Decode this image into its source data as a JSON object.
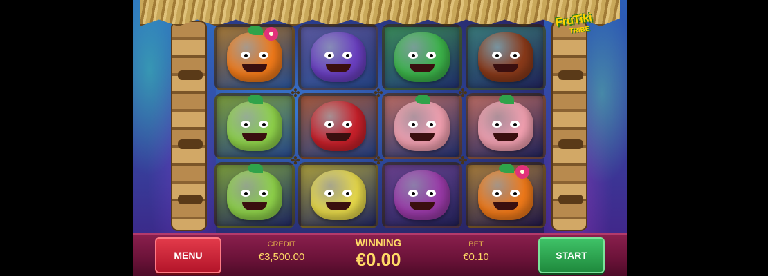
{
  "game": {
    "logo_title": "FruTiki",
    "logo_sub": "TRIBE"
  },
  "reels": [
    [
      {
        "symbol": "orange-flower",
        "bg": "#a57a3a",
        "color": "#f07a1a"
      },
      {
        "symbol": "green-skull",
        "bg": "#7a9a3a",
        "color": "#8ed14a"
      },
      {
        "symbol": "green-skull",
        "bg": "#7a9a3a",
        "color": "#8ed14a"
      }
    ],
    [
      {
        "symbol": "purple-mask",
        "bg": "#5a5aa0",
        "color": "#6a3fc0"
      },
      {
        "symbol": "red-cherries",
        "bg": "#a3563a",
        "color": "#c8202a"
      },
      {
        "symbol": "yellow-fish",
        "bg": "#a89a3a",
        "color": "#e6d84a"
      }
    ],
    [
      {
        "symbol": "green-chomper",
        "bg": "#3a8a5a",
        "color": "#3cb44a"
      },
      {
        "symbol": "pink-dragonfruit",
        "bg": "#b86a62",
        "color": "#f2a0b0"
      },
      {
        "symbol": "purple-grapes",
        "bg": "#6a3f8a",
        "color": "#9a3aa8"
      }
    ],
    [
      {
        "symbol": "coconut-monster",
        "bg": "#3a7a7a",
        "color": "#8a3a1a"
      },
      {
        "symbol": "pink-dragonfruit",
        "bg": "#b86a62",
        "color": "#f2a0b0"
      },
      {
        "symbol": "orange-flower",
        "bg": "#a57a3a",
        "color": "#f07a1a"
      }
    ]
  ],
  "controls": {
    "menu_label": "MENU",
    "start_label": "START",
    "credit_label": "CREDIT",
    "credit_value": "€3,500.00",
    "winning_label": "WINNING",
    "winning_value": "€0.00",
    "bet_label": "BET",
    "bet_value": "€0.10"
  }
}
